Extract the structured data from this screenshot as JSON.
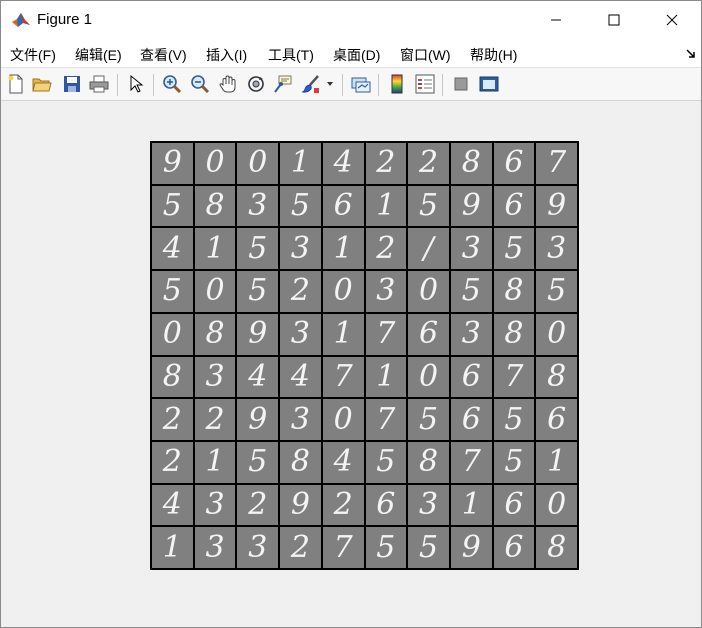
{
  "window": {
    "title": "Figure 1"
  },
  "menu": {
    "items": [
      "文件(F)",
      "编辑(E)",
      "查看(V)",
      "插入(I)",
      "工具(T)",
      "桌面(D)",
      "窗口(W)",
      "帮助(H)"
    ]
  },
  "toolbar": {
    "buttons": [
      {
        "icon": "new-figure-icon"
      },
      {
        "icon": "open-file-icon"
      },
      {
        "icon": "save-icon"
      },
      {
        "icon": "print-icon"
      },
      {
        "icon": "pointer-icon"
      },
      {
        "icon": "zoom-in-icon"
      },
      {
        "icon": "zoom-out-icon"
      },
      {
        "icon": "pan-icon"
      },
      {
        "icon": "rotate-3d-icon"
      },
      {
        "icon": "data-cursor-icon"
      },
      {
        "icon": "brush-icon"
      },
      {
        "icon": "link-plot-icon"
      },
      {
        "icon": "colorbar-icon"
      },
      {
        "icon": "legend-icon"
      },
      {
        "icon": "hide-plot-tools-icon"
      },
      {
        "icon": "show-plot-tools-icon"
      }
    ]
  },
  "colors": {
    "cell_background": "#808080",
    "digit": "#f4f4f4",
    "grid_border": "#000000"
  },
  "digit_grid": {
    "rows": [
      [
        "9",
        "0",
        "0",
        "1",
        "4",
        "2",
        "2",
        "8",
        "6",
        "7"
      ],
      [
        "5",
        "8",
        "3",
        "5",
        "6",
        "1",
        "5",
        "9",
        "6",
        "9"
      ],
      [
        "4",
        "1",
        "5",
        "3",
        "1",
        "2",
        "/",
        "3",
        "5",
        "3"
      ],
      [
        "5",
        "0",
        "5",
        "2",
        "0",
        "3",
        "0",
        "5",
        "8",
        "5"
      ],
      [
        "0",
        "8",
        "9",
        "3",
        "1",
        "7",
        "6",
        "3",
        "8",
        "0"
      ],
      [
        "8",
        "3",
        "4",
        "4",
        "7",
        "1",
        "0",
        "6",
        "7",
        "8"
      ],
      [
        "2",
        "2",
        "9",
        "3",
        "0",
        "7",
        "5",
        "6",
        "5",
        "6"
      ],
      [
        "2",
        "1",
        "5",
        "8",
        "4",
        "5",
        "8",
        "7",
        "5",
        "1"
      ],
      [
        "4",
        "3",
        "2",
        "9",
        "2",
        "6",
        "3",
        "1",
        "6",
        "0"
      ],
      [
        "1",
        "3",
        "3",
        "2",
        "7",
        "5",
        "5",
        "9",
        "6",
        "8"
      ]
    ]
  }
}
